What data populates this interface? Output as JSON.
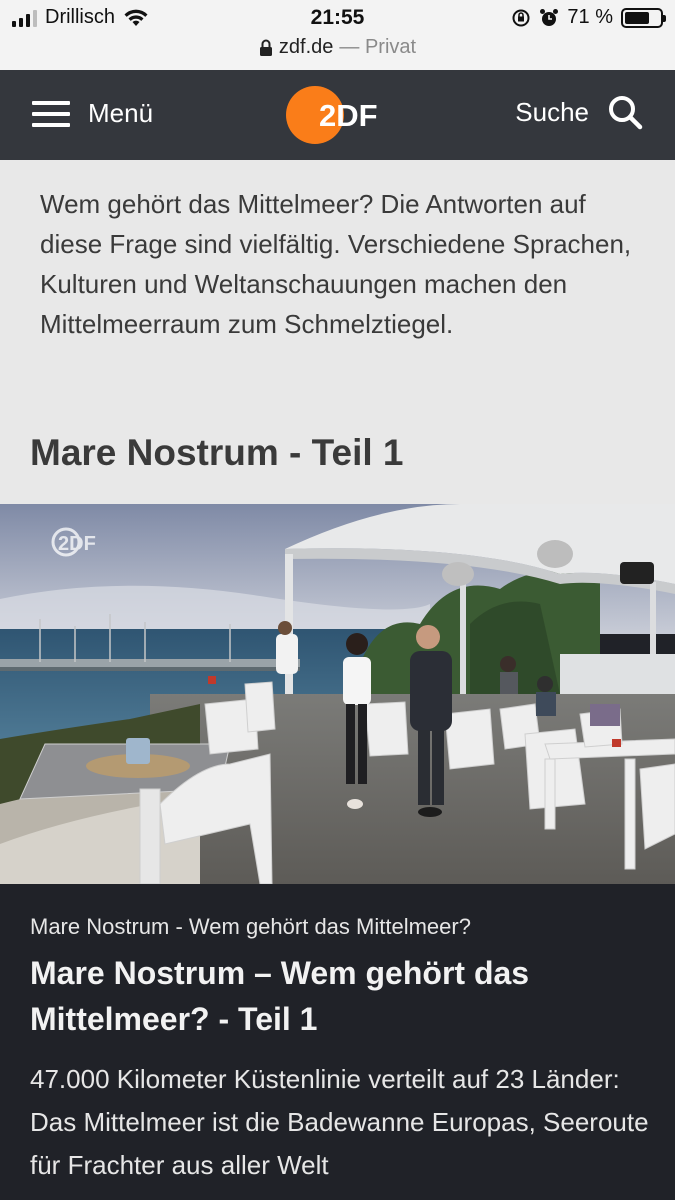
{
  "status_bar": {
    "carrier": "Drillisch",
    "time": "21:55",
    "battery_percent": "71 %",
    "battery_level": 0.71
  },
  "url_bar": {
    "domain": "zdf.de",
    "mode": "— Privat"
  },
  "header": {
    "menu_label": "Menü",
    "logo_text": "2DF",
    "search_label": "Suche",
    "brand_color": "#fa7d19"
  },
  "intro": {
    "text": "Wem gehört das Mittelmeer? Die Antworten auf diese Frage sind vielfältig. Verschiedene Sprachen, Kulturen und Weltanschauungen machen den Mittelmeerraum zum Schmelztiegel.",
    "section_title": "Mare Nostrum - Teil 1"
  },
  "hero": {
    "watermark": "2DF"
  },
  "article": {
    "kicker": "Mare Nostrum - Wem gehört das Mittelmeer?",
    "headline": "Mare Nostrum – Wem gehört das Mittelmeer? - Teil 1",
    "teaser": "47.000 Kilometer Küstenlinie verteilt auf 23 Länder: Das Mittelmeer ist die Badewanne Europas, Seeroute für Frachter aus aller Welt"
  }
}
